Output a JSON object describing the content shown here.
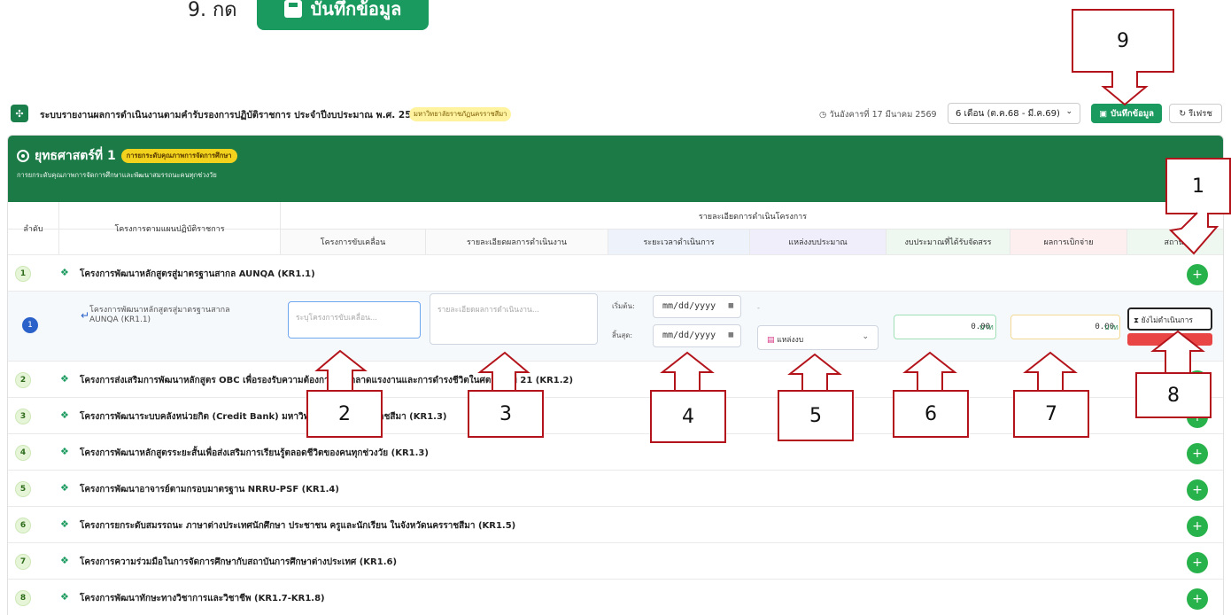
{
  "step_caption": {
    "text": "9. กด",
    "button_label": "บันทึกข้อมูล"
  },
  "header": {
    "title": "ระบบรายงานผลการดำเนินงานตามคำรับรองการปฏิบัติราชการ ประจำปีงบประมาณ พ.ศ. 2569",
    "org": "มหาวิทยาลัยราชภัฏนครราชสีมา",
    "date": "วันอังคารที่ 17 มีนาคม 2569",
    "period": "6 เดือน (ต.ค.68 - มี.ค.69)",
    "save_label": "บันทึกข้อมูล",
    "refresh_label": "รีเฟรช"
  },
  "strategy": {
    "title": "ยุทธศาสตร์ที่ 1",
    "badge": "การยกระดับคุณภาพการจัดการศึกษา",
    "subtitle": "การยกระดับคุณภาพการจัดการศึกษาและพัฒนาสมรรถนะคนทุกช่วงวัย"
  },
  "table": {
    "col_no": "ลำดับ",
    "col_project": "โครงการตามแผนปฏิบัติราชการ",
    "col_group": "รายละเอียดการดำเนินโครงการ",
    "cols": [
      "โครงการขับเคลื่อน",
      "รายละเอียดผลการดำเนินงาน",
      "ระยะเวลาดำเนินการ",
      "แหล่งงบประมาณ",
      "งบประมาณที่ได้รับจัดสรร",
      "ผลการเบิกจ่าย",
      "สถานะ"
    ]
  },
  "projects": [
    {
      "no": "1",
      "name": "โครงการพัฒนาหลักสูตรสู่มาตรฐานสากล AUNQA (KR1.1)"
    },
    {
      "no": "2",
      "name": "โครงการส่งเสริมการพัฒนาหลักสูตร OBC เพื่อรองรับความต้องการของตลาดแรงงานและการดำรงชีวิตในศตวรรษที่ 21 (KR1.2)"
    },
    {
      "no": "3",
      "name": "โครงการพัฒนาระบบคลังหน่วยกิต (Credit Bank) มหาวิทยาลัยราชภัฏนครราชสีมา (KR1.3)"
    },
    {
      "no": "4",
      "name": "โครงการพัฒนาหลักสูตรระยะสั้นเพื่อส่งเสริมการเรียนรู้ตลอดชีวิตของคนทุกช่วงวัย (KR1.3)"
    },
    {
      "no": "5",
      "name": "โครงการพัฒนาอาจารย์ตามกรอบมาตรฐาน NRRU-PSF (KR1.4)"
    },
    {
      "no": "6",
      "name": "โครงการยกระดับสมรรถนะ ภาษาต่างประเทศนักศึกษา ประชาชน ครูและนักเรียน ในจังหวัดนครราชสีมา (KR1.5)"
    },
    {
      "no": "7",
      "name": "โครงการความร่วมมือในการจัดการศึกษากับสถาบันการศึกษาต่างประเทศ (KR1.6)"
    },
    {
      "no": "8",
      "name": "โครงการพัฒนาทักษะทางวิชาการและวิชาชีพ (KR1.7-KR1.8)"
    }
  ],
  "detail": {
    "no": "1",
    "project": "โครงการพัฒนาหลักสูตรสู่มาตรฐานสากล AUNQA (KR1.1)",
    "drive_placeholder": "ระบุโครงการขับเคลื่อน...",
    "result_placeholder": "รายละเอียดผลการดำเนินงาน...",
    "start_label": "เริ่มต้น:",
    "end_label": "สิ้นสุด:",
    "date_placeholder": "mm/dd/yyyy",
    "source_dash": "-",
    "source_label": "แหล่งงบ",
    "budget": "0.00",
    "spent": "0.00",
    "baht": "บาท",
    "status": "ยังไม่ดำเนินการ"
  },
  "callouts": [
    "1",
    "2",
    "3",
    "4",
    "5",
    "6",
    "7",
    "8",
    "9"
  ],
  "colors": {
    "brand_green": "#1b7a45",
    "save_green": "#1a9a5e",
    "callout_red": "#b3141b",
    "add_green": "#28b24b",
    "detail_blue": "#2a62c9"
  }
}
